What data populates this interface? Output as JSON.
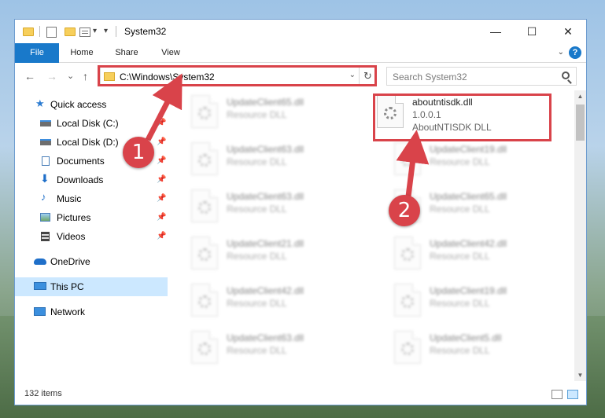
{
  "window": {
    "title": "System32",
    "minimize": "—",
    "maximize": "☐",
    "close": "✕"
  },
  "ribbon": {
    "tabs": [
      "File",
      "Home",
      "Share",
      "View"
    ],
    "help": "?"
  },
  "nav": {
    "back": "←",
    "forward": "→",
    "recent": "⌄",
    "up": "↑",
    "address": "C:\\Windows\\System32",
    "address_dropdown": "⌄",
    "refresh": "↻",
    "search_placeholder": "Search System32"
  },
  "sidebar": {
    "items": [
      {
        "label": "Quick access",
        "icon": "star-icon",
        "pinned": false
      },
      {
        "label": "Local Disk (C:)",
        "icon": "drive-icon",
        "pinned": true
      },
      {
        "label": "Local Disk (D:)",
        "icon": "drive-icon",
        "pinned": true
      },
      {
        "label": "Documents",
        "icon": "document-icon",
        "pinned": true
      },
      {
        "label": "Downloads",
        "icon": "download-icon",
        "pinned": true
      },
      {
        "label": "Music",
        "icon": "music-icon",
        "pinned": true
      },
      {
        "label": "Pictures",
        "icon": "pictures-icon",
        "pinned": true
      },
      {
        "label": "Videos",
        "icon": "video-icon",
        "pinned": true
      },
      {
        "label": "OneDrive",
        "icon": "cloud-icon",
        "pinned": false
      },
      {
        "label": "This PC",
        "icon": "computer-icon",
        "pinned": false,
        "selected": true
      },
      {
        "label": "Network",
        "icon": "network-icon",
        "pinned": false
      }
    ]
  },
  "files": {
    "highlighted": {
      "name": "aboutntisdk.dll",
      "version": "1.0.0.1",
      "description": "AboutNTISDK DLL"
    },
    "left_column": [
      {
        "name": "UpdateClient65.dll",
        "desc": "Resource DLL"
      },
      {
        "name": "UpdateClient63.dll",
        "desc": "Resource DLL"
      },
      {
        "name": "UpdateClient63.dll",
        "desc": "Resource DLL"
      },
      {
        "name": "UpdateClient21.dll",
        "desc": "Resource DLL"
      },
      {
        "name": "UpdateClient42.dll",
        "desc": "Resource DLL"
      },
      {
        "name": "UpdateClient63.dll",
        "desc": "Resource DLL"
      }
    ],
    "right_column": [
      {
        "name": "UpdateClient19.dll",
        "desc": "Resource DLL"
      },
      {
        "name": "UpdateClient65.dll",
        "desc": "Resource DLL"
      },
      {
        "name": "UpdateClient42.dll",
        "desc": "Resource DLL"
      },
      {
        "name": "UpdateClient19.dll",
        "desc": "Resource DLL"
      },
      {
        "name": "UpdateClient5.dll",
        "desc": "Resource DLL"
      }
    ]
  },
  "status": {
    "items_count": "132 items"
  },
  "callouts": [
    "1",
    "2"
  ],
  "colors": {
    "accent": "#1979ca",
    "highlight": "#d9434a",
    "selection": "#cce8ff"
  }
}
